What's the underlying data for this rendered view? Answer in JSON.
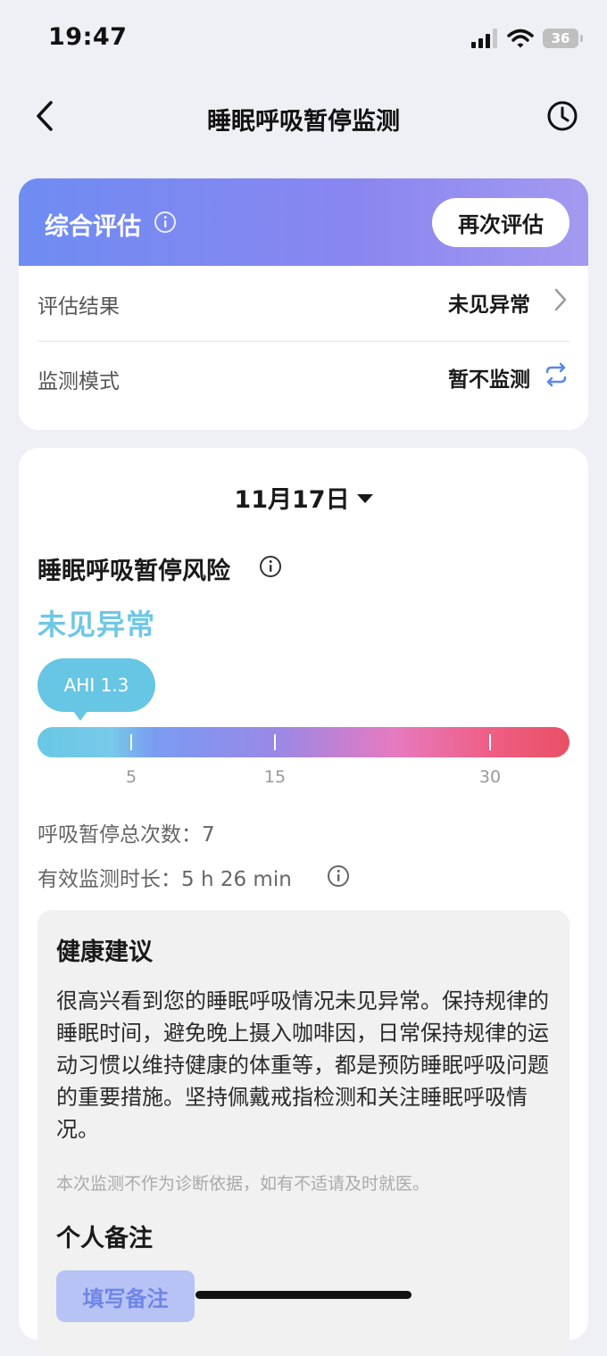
{
  "status_bar": {
    "time": "19:47",
    "battery": "36"
  },
  "nav": {
    "title": "睡眠呼吸暂停监测"
  },
  "overall": {
    "title": "综合评估",
    "reassess_label": "再次评估",
    "rows": [
      {
        "label": "评估结果",
        "value": "未见异常"
      },
      {
        "label": "监测模式",
        "value": "暂不监测"
      }
    ]
  },
  "daily": {
    "date": "11月17日",
    "risk_title": "睡眠呼吸暂停风险",
    "risk_status": "未见异常",
    "ahi_label": "AHI 1.3",
    "ahi_value": 1.3,
    "scale_ticks": [
      "5",
      "15",
      "30"
    ],
    "total_apnea": "呼吸暂停总次数：7",
    "duration": "有效监测时长：5 h 26 min",
    "colors": {
      "accent": "#6fc7e6",
      "gradient_start": "#68c8e4",
      "gradient_end": "#e85064"
    }
  },
  "advice": {
    "title": "健康建议",
    "body": "很高兴看到您的睡眠呼吸情况未见异常。保持规律的睡眠时间，避免晚上摄入咖啡因，日常保持规律的运动习惯以维持健康的体重等，都是预防睡眠呼吸问题的重要措施。坚持佩戴戒指检测和关注睡眠呼吸情况。",
    "disclaimer": "本次监测不作为诊断依据，如有不适请及时就医。"
  },
  "notes": {
    "title": "个人备注",
    "button_label": "填写备注"
  }
}
